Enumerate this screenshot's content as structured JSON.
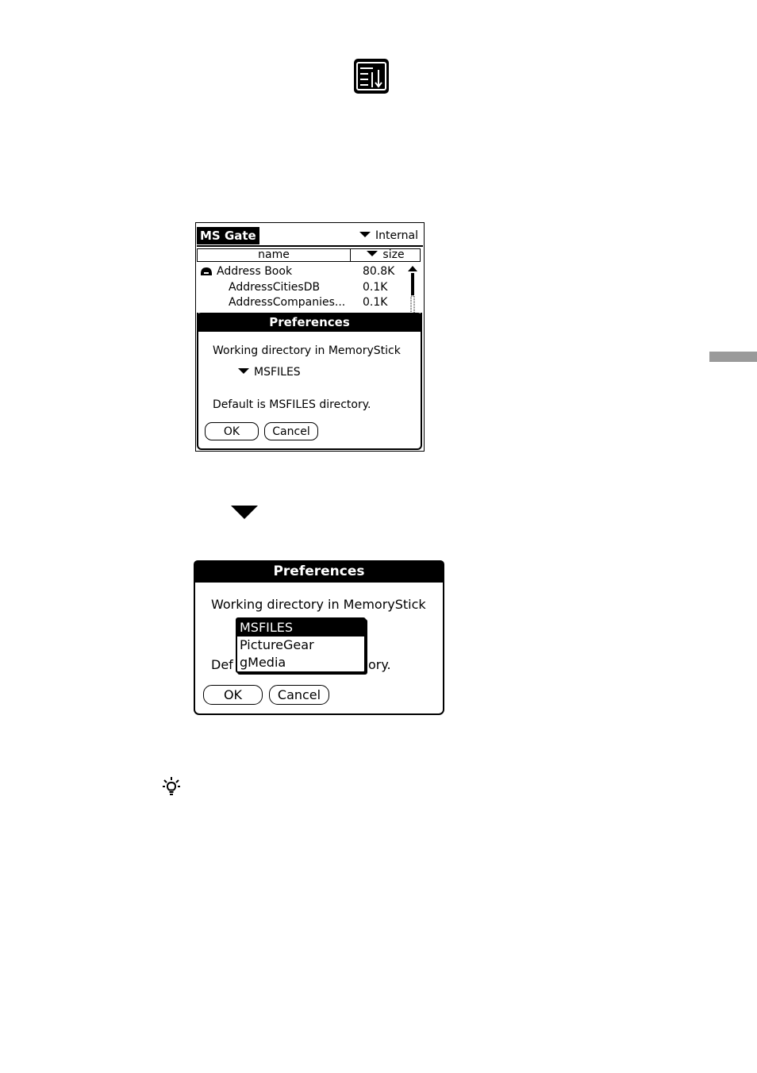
{
  "app_icon": "ms-gate-sort-icon",
  "screen1": {
    "title": "MS Gate",
    "category": "Internal",
    "columns": {
      "name": "name",
      "size": "size"
    },
    "rows": [
      {
        "name": "Address Book",
        "size": "80.8K",
        "icon": "record-icon"
      },
      {
        "name": "AddressCitiesDB",
        "size": "0.1K"
      },
      {
        "name": "AddressCompanies...",
        "size": "0.1K"
      }
    ],
    "dialog": {
      "title": "Preferences",
      "label": "Working directory in MemoryStick",
      "selected": "MSFILES",
      "default_text": "Default is MSFILES directory.",
      "ok": "OK",
      "cancel": "Cancel"
    }
  },
  "screen2": {
    "dialog": {
      "title": "Preferences",
      "label": "Working directory in MemoryStick",
      "options": [
        "MSFILES",
        "PictureGear",
        "gMedia"
      ],
      "selected_index": 0,
      "default_pre": "Def",
      "default_post": "ory.",
      "ok": "OK",
      "cancel": "Cancel"
    }
  },
  "tip_icon": "lightbulb-icon",
  "colors": {
    "side_tab": "#9a9a9a",
    "ink": "#000000"
  }
}
